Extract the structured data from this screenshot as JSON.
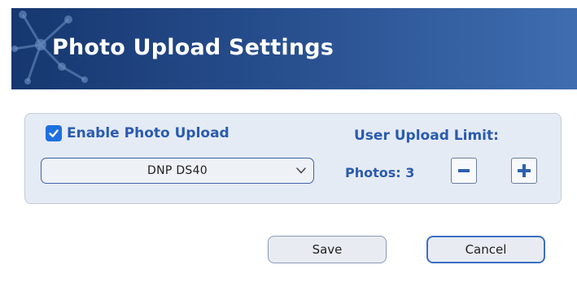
{
  "header": {
    "title": "Photo Upload Settings",
    "decoration_icon": "network-nodes-icon"
  },
  "upload": {
    "enable_checked": true,
    "enable_label": "Enable Photo Upload",
    "printer_selected": "DNP DS40",
    "limit_label": "User Upload Limit:",
    "photos_label": "Photos: 3",
    "photos_count": 3
  },
  "actions": {
    "save_label": "Save",
    "cancel_label": "Cancel"
  },
  "colors": {
    "header_dark": "#16376f",
    "header_light": "#3f6db0",
    "accent_text": "#2a5bb0",
    "checkbox": "#1f6fe0",
    "panel_bg": "#e5ebf4"
  }
}
